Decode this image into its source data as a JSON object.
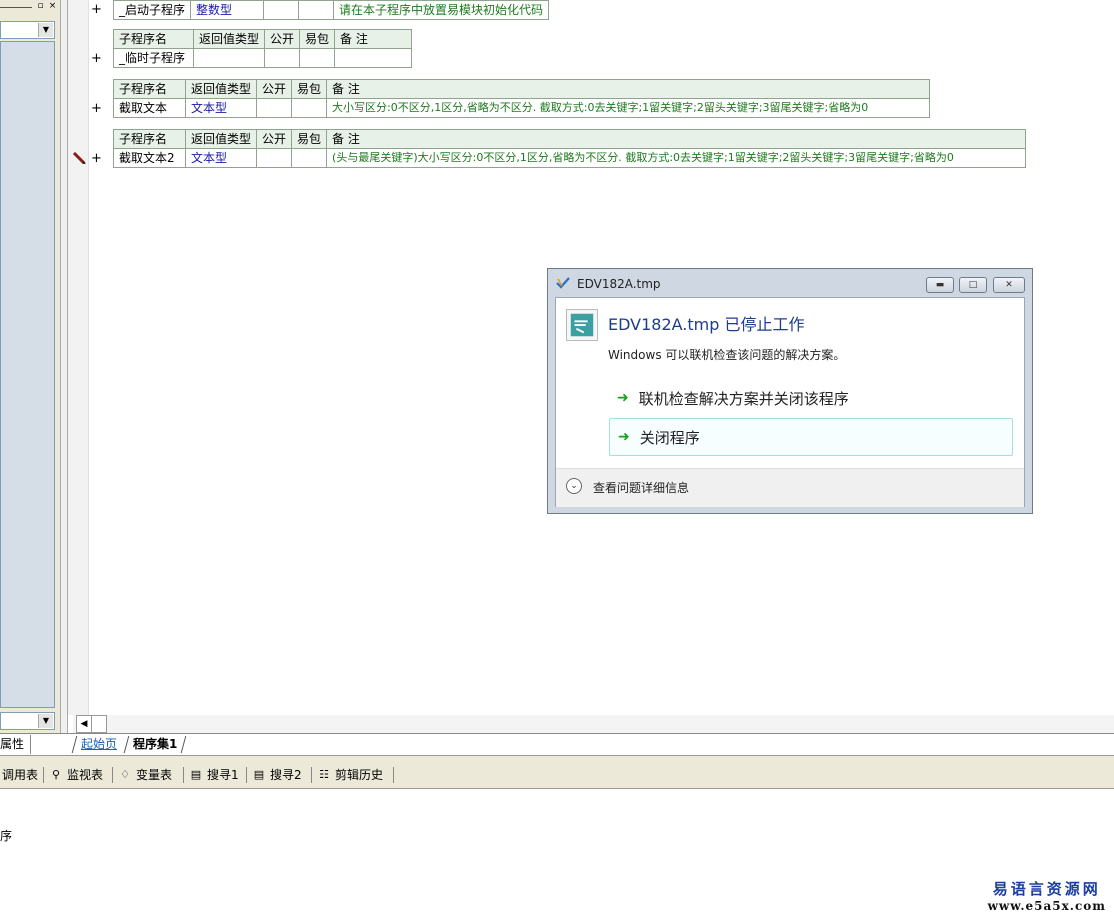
{
  "left_panel": {
    "pin": "▫",
    "close": "×",
    "bottom_tab": "属性"
  },
  "rows": [
    {
      "header": null,
      "values": {
        "name": "_启动子程序",
        "type": "整数型",
        "public": "",
        "pack": "",
        "note": "请在本子程序中放置易模块初始化代码"
      }
    },
    {
      "header": {
        "name": "子程序名",
        "type": "返回值类型",
        "public": "公开",
        "pack": "易包",
        "note": "备 注"
      },
      "values": {
        "name": "_临时子程序",
        "type": "",
        "public": "",
        "pack": "",
        "note": ""
      }
    },
    {
      "header": {
        "name": "子程序名",
        "type": "返回值类型",
        "public": "公开",
        "pack": "易包",
        "note": "备 注"
      },
      "values": {
        "name": "截取文本",
        "type": "文本型",
        "public": "",
        "pack": "",
        "note": "大小写区分:0不区分,1区分,省略为不区分. 截取方式:0去关键字;1留关键字;2留头关键字;3留尾关键字;省略为0"
      }
    },
    {
      "header": {
        "name": "子程序名",
        "type": "返回值类型",
        "public": "公开",
        "pack": "易包",
        "note": "备 注"
      },
      "values": {
        "name": "截取文本2",
        "type": "文本型",
        "public": "",
        "pack": "",
        "note": "(头与最尾关键字)大小写区分:0不区分,1区分,省略为不区分. 截取方式:0去关键字;1留关键字;2留头关键字;3留尾关键字;省略为0"
      }
    }
  ],
  "plus_symbol": "+",
  "tabs": {
    "start": "起始页",
    "set": "程序集1"
  },
  "toolbar": {
    "call_table": "调用表",
    "watch_table": "监视表",
    "var_table": "变量表",
    "search1": "搜寻1",
    "search2": "搜寻2",
    "clip_history": "剪辑历史"
  },
  "output": {
    "text": "序"
  },
  "watermark": {
    "cn": "易语言资源网",
    "url": "www.e5a5x.com"
  },
  "dialog": {
    "title": "EDV182A.tmp",
    "heading": "EDV182A.tmp 已停止工作",
    "description": "Windows 可以联机检查该问题的解决方案。",
    "option_check": "联机检查解决方案并关闭该程序",
    "option_close": "关闭程序",
    "details": "查看问题详细信息",
    "colors": {
      "accent": "#1e3c8c",
      "arrow": "#1aa11a",
      "focus_border": "#a8dde8"
    }
  }
}
